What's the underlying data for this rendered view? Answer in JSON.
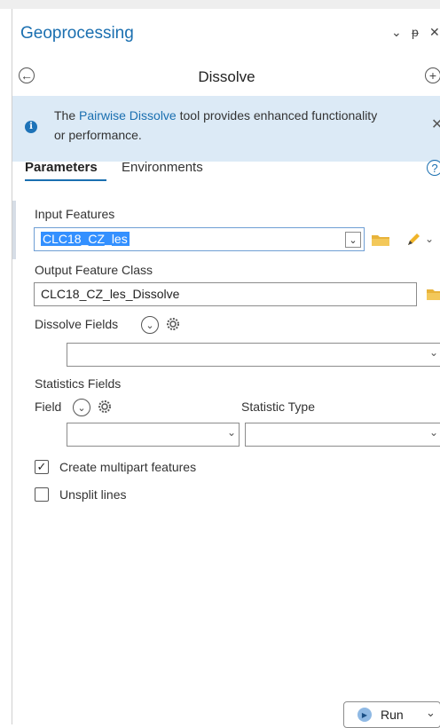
{
  "header": {
    "title": "Geoprocessing",
    "menu_glyph": "⌄",
    "pin_glyph": "ᵽ",
    "close_glyph": "✕"
  },
  "tool": {
    "name": "Dissolve",
    "back_glyph": "←",
    "add_glyph": "+"
  },
  "banner": {
    "text_before": "The ",
    "link_text": "Pairwise Dissolve",
    "text_after": " tool provides enhanced functionality or performance.",
    "info_glyph": "i",
    "close_glyph": "✕"
  },
  "tabs": {
    "active": "Parameters",
    "inactive": "Environments",
    "help_glyph": "?"
  },
  "params": {
    "input_label": "Input Features",
    "input_value": "CLC18_CZ_les",
    "output_label": "Output Feature Class",
    "output_value": "CLC18_CZ_les_Dissolve",
    "dissolve_label": "Dissolve Fields",
    "dissolve_value": "",
    "stats_label": "Statistics Fields",
    "field_label": "Field",
    "stat_type_label": "Statistic Type",
    "field_value": "",
    "stat_type_value": ""
  },
  "options": {
    "multipart_label": "Create multipart features",
    "multipart_checked": true,
    "unsplit_label": "Unsplit lines",
    "unsplit_checked": false
  },
  "run": {
    "label": "Run",
    "play_glyph": "▶",
    "dropdown_glyph": "⌄"
  },
  "colors": {
    "accent": "#1a6fb0",
    "banner_bg": "#dceaf6",
    "folder": "#e8b33a",
    "selection": "#3390ff"
  }
}
